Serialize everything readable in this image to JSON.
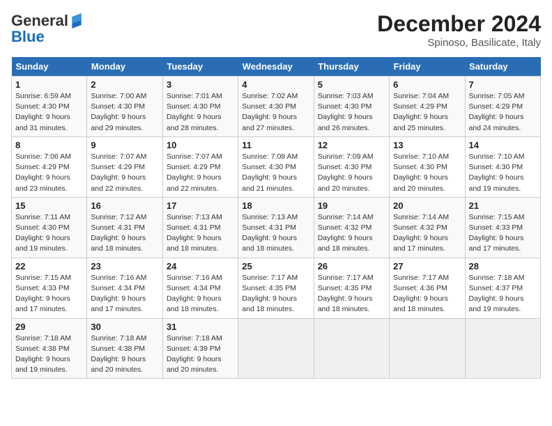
{
  "header": {
    "logo_line1": "General",
    "logo_line2": "Blue",
    "title": "December 2024",
    "subtitle": "Spinoso, Basilicate, Italy"
  },
  "weekdays": [
    "Sunday",
    "Monday",
    "Tuesday",
    "Wednesday",
    "Thursday",
    "Friday",
    "Saturday"
  ],
  "weeks": [
    [
      {
        "day": "1",
        "sunrise": "Sunrise: 6:59 AM",
        "sunset": "Sunset: 4:30 PM",
        "daylight": "Daylight: 9 hours and 31 minutes."
      },
      {
        "day": "2",
        "sunrise": "Sunrise: 7:00 AM",
        "sunset": "Sunset: 4:30 PM",
        "daylight": "Daylight: 9 hours and 29 minutes."
      },
      {
        "day": "3",
        "sunrise": "Sunrise: 7:01 AM",
        "sunset": "Sunset: 4:30 PM",
        "daylight": "Daylight: 9 hours and 28 minutes."
      },
      {
        "day": "4",
        "sunrise": "Sunrise: 7:02 AM",
        "sunset": "Sunset: 4:30 PM",
        "daylight": "Daylight: 9 hours and 27 minutes."
      },
      {
        "day": "5",
        "sunrise": "Sunrise: 7:03 AM",
        "sunset": "Sunset: 4:30 PM",
        "daylight": "Daylight: 9 hours and 26 minutes."
      },
      {
        "day": "6",
        "sunrise": "Sunrise: 7:04 AM",
        "sunset": "Sunset: 4:29 PM",
        "daylight": "Daylight: 9 hours and 25 minutes."
      },
      {
        "day": "7",
        "sunrise": "Sunrise: 7:05 AM",
        "sunset": "Sunset: 4:29 PM",
        "daylight": "Daylight: 9 hours and 24 minutes."
      }
    ],
    [
      {
        "day": "8",
        "sunrise": "Sunrise: 7:06 AM",
        "sunset": "Sunset: 4:29 PM",
        "daylight": "Daylight: 9 hours and 23 minutes."
      },
      {
        "day": "9",
        "sunrise": "Sunrise: 7:07 AM",
        "sunset": "Sunset: 4:29 PM",
        "daylight": "Daylight: 9 hours and 22 minutes."
      },
      {
        "day": "10",
        "sunrise": "Sunrise: 7:07 AM",
        "sunset": "Sunset: 4:29 PM",
        "daylight": "Daylight: 9 hours and 22 minutes."
      },
      {
        "day": "11",
        "sunrise": "Sunrise: 7:08 AM",
        "sunset": "Sunset: 4:30 PM",
        "daylight": "Daylight: 9 hours and 21 minutes."
      },
      {
        "day": "12",
        "sunrise": "Sunrise: 7:09 AM",
        "sunset": "Sunset: 4:30 PM",
        "daylight": "Daylight: 9 hours and 20 minutes."
      },
      {
        "day": "13",
        "sunrise": "Sunrise: 7:10 AM",
        "sunset": "Sunset: 4:30 PM",
        "daylight": "Daylight: 9 hours and 20 minutes."
      },
      {
        "day": "14",
        "sunrise": "Sunrise: 7:10 AM",
        "sunset": "Sunset: 4:30 PM",
        "daylight": "Daylight: 9 hours and 19 minutes."
      }
    ],
    [
      {
        "day": "15",
        "sunrise": "Sunrise: 7:11 AM",
        "sunset": "Sunset: 4:30 PM",
        "daylight": "Daylight: 9 hours and 19 minutes."
      },
      {
        "day": "16",
        "sunrise": "Sunrise: 7:12 AM",
        "sunset": "Sunset: 4:31 PM",
        "daylight": "Daylight: 9 hours and 18 minutes."
      },
      {
        "day": "17",
        "sunrise": "Sunrise: 7:13 AM",
        "sunset": "Sunset: 4:31 PM",
        "daylight": "Daylight: 9 hours and 18 minutes."
      },
      {
        "day": "18",
        "sunrise": "Sunrise: 7:13 AM",
        "sunset": "Sunset: 4:31 PM",
        "daylight": "Daylight: 9 hours and 18 minutes."
      },
      {
        "day": "19",
        "sunrise": "Sunrise: 7:14 AM",
        "sunset": "Sunset: 4:32 PM",
        "daylight": "Daylight: 9 hours and 18 minutes."
      },
      {
        "day": "20",
        "sunrise": "Sunrise: 7:14 AM",
        "sunset": "Sunset: 4:32 PM",
        "daylight": "Daylight: 9 hours and 17 minutes."
      },
      {
        "day": "21",
        "sunrise": "Sunrise: 7:15 AM",
        "sunset": "Sunset: 4:33 PM",
        "daylight": "Daylight: 9 hours and 17 minutes."
      }
    ],
    [
      {
        "day": "22",
        "sunrise": "Sunrise: 7:15 AM",
        "sunset": "Sunset: 4:33 PM",
        "daylight": "Daylight: 9 hours and 17 minutes."
      },
      {
        "day": "23",
        "sunrise": "Sunrise: 7:16 AM",
        "sunset": "Sunset: 4:34 PM",
        "daylight": "Daylight: 9 hours and 17 minutes."
      },
      {
        "day": "24",
        "sunrise": "Sunrise: 7:16 AM",
        "sunset": "Sunset: 4:34 PM",
        "daylight": "Daylight: 9 hours and 18 minutes."
      },
      {
        "day": "25",
        "sunrise": "Sunrise: 7:17 AM",
        "sunset": "Sunset: 4:35 PM",
        "daylight": "Daylight: 9 hours and 18 minutes."
      },
      {
        "day": "26",
        "sunrise": "Sunrise: 7:17 AM",
        "sunset": "Sunset: 4:35 PM",
        "daylight": "Daylight: 9 hours and 18 minutes."
      },
      {
        "day": "27",
        "sunrise": "Sunrise: 7:17 AM",
        "sunset": "Sunset: 4:36 PM",
        "daylight": "Daylight: 9 hours and 18 minutes."
      },
      {
        "day": "28",
        "sunrise": "Sunrise: 7:18 AM",
        "sunset": "Sunset: 4:37 PM",
        "daylight": "Daylight: 9 hours and 19 minutes."
      }
    ],
    [
      {
        "day": "29",
        "sunrise": "Sunrise: 7:18 AM",
        "sunset": "Sunset: 4:38 PM",
        "daylight": "Daylight: 9 hours and 19 minutes."
      },
      {
        "day": "30",
        "sunrise": "Sunrise: 7:18 AM",
        "sunset": "Sunset: 4:38 PM",
        "daylight": "Daylight: 9 hours and 20 minutes."
      },
      {
        "day": "31",
        "sunrise": "Sunrise: 7:18 AM",
        "sunset": "Sunset: 4:39 PM",
        "daylight": "Daylight: 9 hours and 20 minutes."
      },
      null,
      null,
      null,
      null
    ]
  ]
}
